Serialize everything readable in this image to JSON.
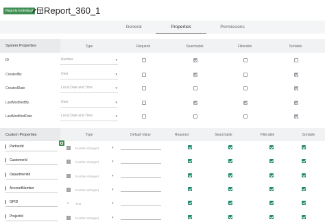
{
  "header": {
    "badge": "Reports Individual",
    "title": "Report_360_1",
    "edit_icon": "pencil-icon",
    "report_icon": "report-grid-icon"
  },
  "tabs": [
    "General",
    "Properties",
    "Permissions"
  ],
  "active_tab": "Properties",
  "system": {
    "title": "System Properties",
    "columns": [
      "Type",
      "Required",
      "Searchable",
      "Filterable",
      "Sortable"
    ],
    "rows": [
      {
        "name": "ID",
        "type": "Number",
        "required": false,
        "searchable": true,
        "filterable": false,
        "sortable": false
      },
      {
        "name": "CreatedBy",
        "type": "User",
        "required": false,
        "searchable": true,
        "filterable": false,
        "sortable": true
      },
      {
        "name": "CreatedDate",
        "type": "Local Date and Time",
        "required": false,
        "searchable": false,
        "filterable": false,
        "sortable": true
      },
      {
        "name": "LastModifiedBy",
        "type": "User",
        "required": false,
        "searchable": true,
        "filterable": true,
        "sortable": true
      },
      {
        "name": "LastModifiedDate",
        "type": "Local Date and Time",
        "required": false,
        "searchable": false,
        "filterable": false,
        "sortable": true
      }
    ]
  },
  "custom": {
    "title": "Custom Properties",
    "columns": [
      "Type",
      "Default Value",
      "Required",
      "Searchable",
      "Filterable",
      "Sortable"
    ],
    "rows": [
      {
        "name": "PartnerId",
        "type_icon": "1",
        "type": "Number (Integer)",
        "required": true,
        "searchable": true,
        "filterable": true,
        "sortable": true
      },
      {
        "name": "CustomerId",
        "type_icon": "1",
        "type": "Number (Integer)",
        "required": true,
        "searchable": true,
        "filterable": true,
        "sortable": true
      },
      {
        "name": "DepartmentId",
        "type_icon": "1",
        "type": "Number (Integer)",
        "required": true,
        "searchable": true,
        "filterable": true,
        "sortable": true
      },
      {
        "name": "AccountNumber",
        "type_icon": "1",
        "type": "Number (Integer)",
        "required": true,
        "searchable": true,
        "filterable": true,
        "sortable": true
      },
      {
        "name": "GPID",
        "type_icon": "Tt",
        "type": "Text",
        "required": true,
        "searchable": true,
        "filterable": true,
        "sortable": true
      },
      {
        "name": "ProjectId",
        "type_icon": "1",
        "type": "Number (Integer)",
        "required": true,
        "searchable": true,
        "filterable": true,
        "sortable": true
      }
    ]
  }
}
